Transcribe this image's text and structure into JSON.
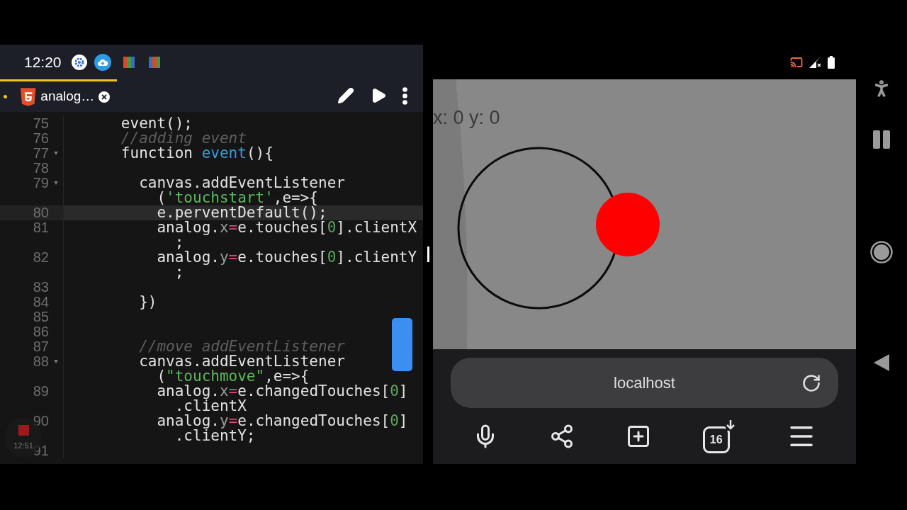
{
  "status_bar": {
    "time": "12:20"
  },
  "editor": {
    "tab": {
      "title": "analog…",
      "modified": true,
      "selected": true
    },
    "lines": [
      {
        "number": "75",
        "current": false,
        "foldable": false,
        "rows": [
          [
            {
              "kind": "text",
              "text": "      event();"
            }
          ]
        ]
      },
      {
        "number": "76",
        "current": false,
        "foldable": false,
        "rows": [
          [
            {
              "kind": "comment",
              "text": "      //adding event"
            }
          ]
        ]
      },
      {
        "number": "77",
        "current": false,
        "foldable": true,
        "rows": [
          [
            {
              "kind": "text",
              "text": "      function "
            },
            {
              "kind": "name",
              "text": "event"
            },
            {
              "kind": "text",
              "text": "(){"
            }
          ]
        ]
      },
      {
        "number": "78",
        "current": false,
        "foldable": false,
        "rows": [
          []
        ]
      },
      {
        "number": "79",
        "current": false,
        "foldable": true,
        "rows": [
          [
            {
              "kind": "text",
              "text": "        canvas.addEventListener"
            }
          ],
          [
            {
              "kind": "text",
              "text": "          ("
            },
            {
              "kind": "string",
              "text": "'touchstart'"
            },
            {
              "kind": "text",
              "text": ",e=>{"
            }
          ]
        ]
      },
      {
        "number": "80",
        "current": true,
        "foldable": false,
        "rows": [
          [
            {
              "kind": "text",
              "text": "          e.perventDefault();"
            }
          ]
        ]
      },
      {
        "number": "81",
        "current": false,
        "foldable": false,
        "rows": [
          [
            {
              "kind": "text",
              "text": "          analog."
            },
            {
              "kind": "prop",
              "text": "x"
            },
            {
              "kind": "op",
              "text": "="
            },
            {
              "kind": "text",
              "text": "e.touches["
            },
            {
              "kind": "num",
              "text": "0"
            },
            {
              "kind": "text",
              "text": "].clientX"
            }
          ],
          [
            {
              "kind": "text",
              "text": "            ;"
            }
          ]
        ]
      },
      {
        "number": "82",
        "current": false,
        "foldable": false,
        "rows": [
          [
            {
              "kind": "text",
              "text": "          analog."
            },
            {
              "kind": "prop",
              "text": "y"
            },
            {
              "kind": "op",
              "text": "="
            },
            {
              "kind": "text",
              "text": "e.touches["
            },
            {
              "kind": "num",
              "text": "0"
            },
            {
              "kind": "text",
              "text": "].clientY"
            }
          ],
          [
            {
              "kind": "text",
              "text": "            ;"
            }
          ]
        ]
      },
      {
        "number": "83",
        "current": false,
        "foldable": false,
        "rows": [
          []
        ]
      },
      {
        "number": "84",
        "current": false,
        "foldable": false,
        "rows": [
          [
            {
              "kind": "text",
              "text": "        })"
            }
          ]
        ]
      },
      {
        "number": "85",
        "current": false,
        "foldable": false,
        "rows": [
          []
        ]
      },
      {
        "number": "86",
        "current": false,
        "foldable": false,
        "rows": [
          []
        ]
      },
      {
        "number": "87",
        "current": false,
        "foldable": false,
        "rows": [
          [
            {
              "kind": "comment",
              "text": "        //move addEventListener"
            }
          ]
        ]
      },
      {
        "number": "88",
        "current": false,
        "foldable": true,
        "rows": [
          [
            {
              "kind": "text",
              "text": "        canvas.addEventListener"
            }
          ],
          [
            {
              "kind": "text",
              "text": "          ("
            },
            {
              "kind": "string",
              "text": "\"touchmove\""
            },
            {
              "kind": "text",
              "text": ",e=>{"
            }
          ]
        ]
      },
      {
        "number": "89",
        "current": false,
        "foldable": false,
        "rows": [
          [
            {
              "kind": "text",
              "text": "          analog."
            },
            {
              "kind": "prop",
              "text": "x"
            },
            {
              "kind": "op",
              "text": "="
            },
            {
              "kind": "text",
              "text": "e.changedTouches["
            },
            {
              "kind": "num",
              "text": "0"
            },
            {
              "kind": "text",
              "text": "]"
            }
          ],
          [
            {
              "kind": "text",
              "text": "            .clientX"
            }
          ]
        ]
      },
      {
        "number": "90",
        "current": false,
        "foldable": false,
        "rows": [
          [
            {
              "kind": "text",
              "text": "          analog."
            },
            {
              "kind": "prop",
              "text": "y"
            },
            {
              "kind": "op",
              "text": "="
            },
            {
              "kind": "text",
              "text": "e.changedTouches["
            },
            {
              "kind": "num",
              "text": "0"
            },
            {
              "kind": "text",
              "text": "]"
            }
          ],
          [
            {
              "kind": "text",
              "text": "            .clientY;"
            }
          ]
        ]
      },
      {
        "number": "91",
        "current": false,
        "foldable": false,
        "rows": [
          []
        ]
      }
    ]
  },
  "recorder": {
    "time": "12:51"
  },
  "browser": {
    "canvas": {
      "readout": "x: 0 y: 0"
    },
    "address": "localhost",
    "toolbar": [
      {
        "kind": "mic"
      },
      {
        "kind": "share"
      },
      {
        "kind": "new-tab"
      },
      {
        "kind": "tabs",
        "count": "16"
      },
      {
        "kind": "menu"
      }
    ]
  }
}
